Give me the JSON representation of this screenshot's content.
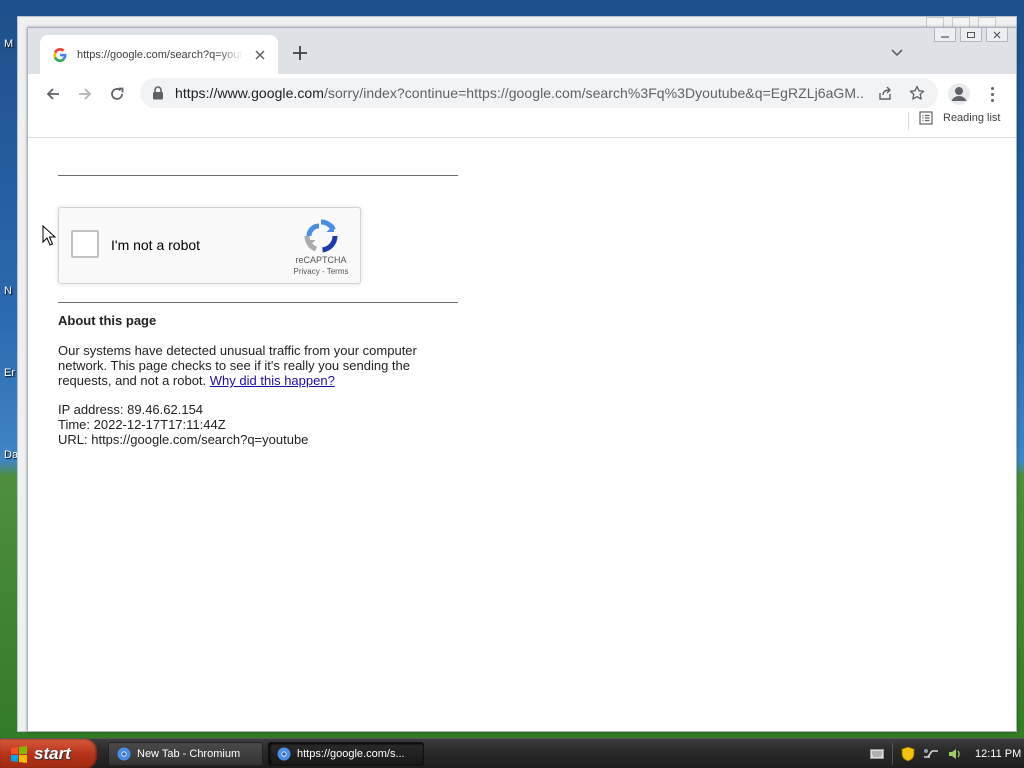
{
  "desktop": {
    "labels": [
      "M",
      "N",
      "Er",
      "Da"
    ]
  },
  "browser": {
    "tab": {
      "title": "https://google.com/search?q=youtube"
    },
    "address_bar": {
      "host_part": "https://www.google.com",
      "rest_part": "/sorry/index?continue=https://google.com/search%3Fq%3Dyoutube&q=EgRZLj6aGM..."
    },
    "bookmarks_bar": {
      "reading_list_label": "Reading list"
    }
  },
  "page": {
    "recaptcha": {
      "checkbox_label": "I'm not a robot",
      "brand": "reCAPTCHA",
      "privacy": "Privacy",
      "separator": " - ",
      "terms": "Terms"
    },
    "about_title": "About this page",
    "about_text": "Our systems have detected unusual traffic from your computer network. This page checks to see if it's really you sending the requests, and not a robot.",
    "why_link": "Why did this happen?",
    "ip_line": "IP address: 89.46.62.154",
    "time_line": "Time: 2022-12-17T17:11:44Z",
    "url_line": "URL: https://google.com/search?q=youtube"
  },
  "taskbar": {
    "start_label": "start",
    "items": [
      {
        "label": "New Tab - Chromium"
      },
      {
        "label": "https://google.com/s..."
      }
    ],
    "clock": "12:11 PM"
  },
  "colors": {
    "link": "#1a0dab",
    "recaptcha_blue": "#4a90e2",
    "start_button": "#b8321a"
  }
}
